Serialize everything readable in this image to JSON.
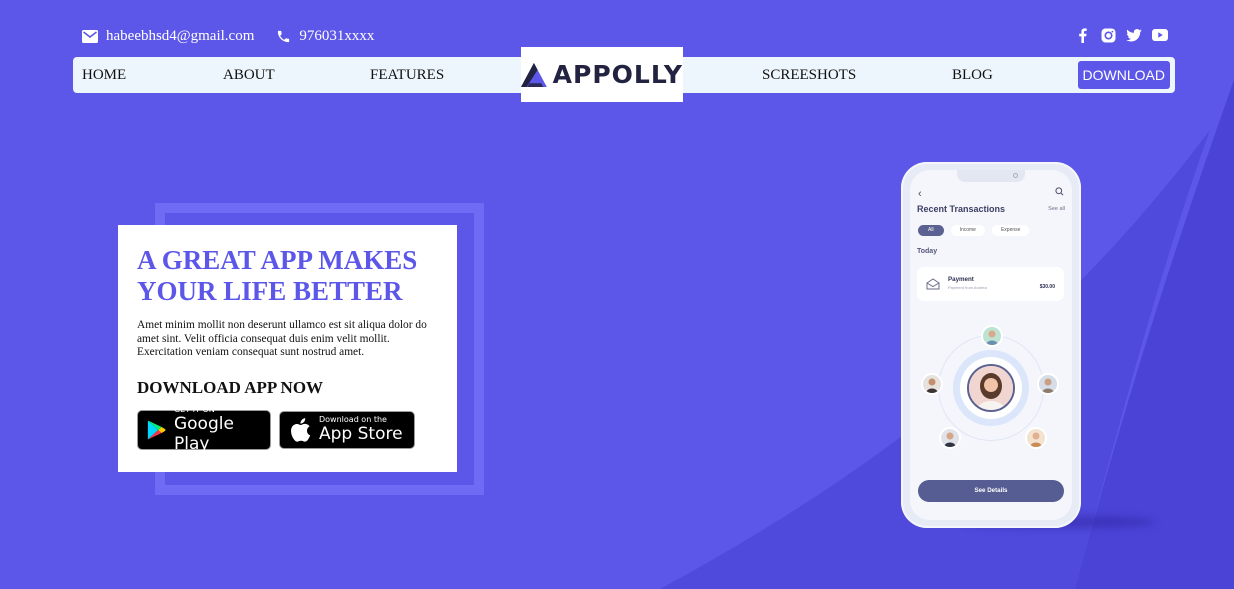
{
  "contact": {
    "email": "habeebhsd4@gmail.com",
    "phone": "976031xxxx"
  },
  "social": [
    "facebook-icon",
    "instagram-icon",
    "twitter-icon",
    "youtube-icon"
  ],
  "nav": {
    "items": [
      "HOME",
      "ABOUT",
      "FEATURES",
      "SCREESHOTS",
      "BLOG"
    ],
    "download": "DOWNLOAD",
    "logo": "APPOLLY"
  },
  "hero": {
    "headline": "A GREAT APP MAKES YOUR LIFE BETTER",
    "paragraph": "Amet minim mollit non deserunt ullamco est sit aliqua dolor do amet sint. Velit officia consequat duis enim velit mollit. Exercitation veniam consequat sunt nostrud amet.",
    "download_title": "DOWNLOAD APP NOW",
    "google_small": "GET IT ON",
    "google_big": "Google Play",
    "apple_small": "Download on the",
    "apple_big": "App Store"
  },
  "phone": {
    "title": "Recent Transactions",
    "see_all": "See all",
    "chips": [
      "All",
      "Income",
      "Expense"
    ],
    "section": "Today",
    "tx_title": "Payment",
    "tx_sub": "Payment from Andrea",
    "tx_amount": "$30.00",
    "button": "See Details"
  },
  "colors": {
    "background": "#5c57e8",
    "accent": "#5c57e8",
    "nav_bg": "#eef6fd",
    "frame": "#6f6bf5"
  }
}
